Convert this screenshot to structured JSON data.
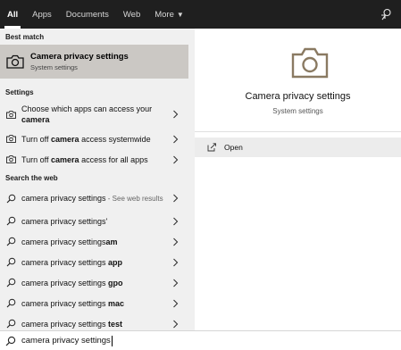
{
  "tabs": [
    {
      "label": "All"
    },
    {
      "label": "Apps"
    },
    {
      "label": "Documents"
    },
    {
      "label": "Web"
    },
    {
      "label": "More"
    }
  ],
  "best_match": {
    "header": "Best match",
    "title": "Camera privacy settings",
    "subtitle": "System settings"
  },
  "settings": {
    "header": "Settings",
    "items": [
      {
        "pre": "Choose which apps can access your ",
        "bold": "camera",
        "post": ""
      },
      {
        "pre": "Turn off ",
        "bold": "camera",
        "post": " access systemwide"
      },
      {
        "pre": "Turn off ",
        "bold": "camera",
        "post": " access for all apps"
      }
    ]
  },
  "web": {
    "header": "Search the web",
    "items": [
      {
        "query": "camera privacy settings",
        "bold": "",
        "suffix": " - See web results"
      },
      {
        "query": "camera privacy settings'",
        "bold": "",
        "suffix": ""
      },
      {
        "query": "camera privacy settings",
        "bold": "am",
        "suffix": ""
      },
      {
        "query": "camera privacy settings ",
        "bold": "app",
        "suffix": ""
      },
      {
        "query": "camera privacy settings ",
        "bold": "gpo",
        "suffix": ""
      },
      {
        "query": "camera privacy settings ",
        "bold": "mac",
        "suffix": ""
      },
      {
        "query": "camera privacy settings ",
        "bold": "test",
        "suffix": ""
      }
    ]
  },
  "preview": {
    "title": "Camera privacy settings",
    "subtitle": "System settings",
    "open_label": "Open"
  },
  "search": {
    "query": "camera privacy settings"
  },
  "colors": {
    "topbar": "#1f1f1f",
    "selected": "#cbc8c4",
    "accent_icon": "#8a7a62"
  }
}
